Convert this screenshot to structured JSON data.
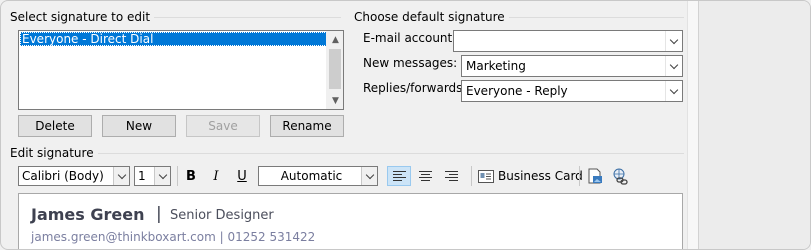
{
  "select_group": {
    "label": "Select signature to edit",
    "signatures": [
      "Everyone - Direct Dial"
    ]
  },
  "sig_buttons": {
    "delete": "Delete",
    "new": "New",
    "save": "Save",
    "rename": "Rename"
  },
  "default_group": {
    "label": "Choose default signature",
    "email_account_label": "E-mail account:",
    "email_account_value": "",
    "new_messages_label": "New messages:",
    "new_messages_value": "Marketing",
    "replies_label": "Replies/forwards:",
    "replies_value": "Everyone - Reply"
  },
  "edit_group": {
    "label": "Edit signature"
  },
  "toolbar": {
    "font": "Calibri (Body)",
    "size": "1",
    "bold": "B",
    "italic": "I",
    "underline": "U",
    "color": "Automatic",
    "business_card": "Business Card"
  },
  "signature": {
    "name": "James Green",
    "separator": "|",
    "title": "Senior Designer",
    "contact": "james.green@thinkboxart.com  |  01252 531422"
  },
  "colors": {
    "selection": "#0078d7",
    "signature_text": "#3e4150",
    "signature_contact": "#7b7fa0"
  }
}
